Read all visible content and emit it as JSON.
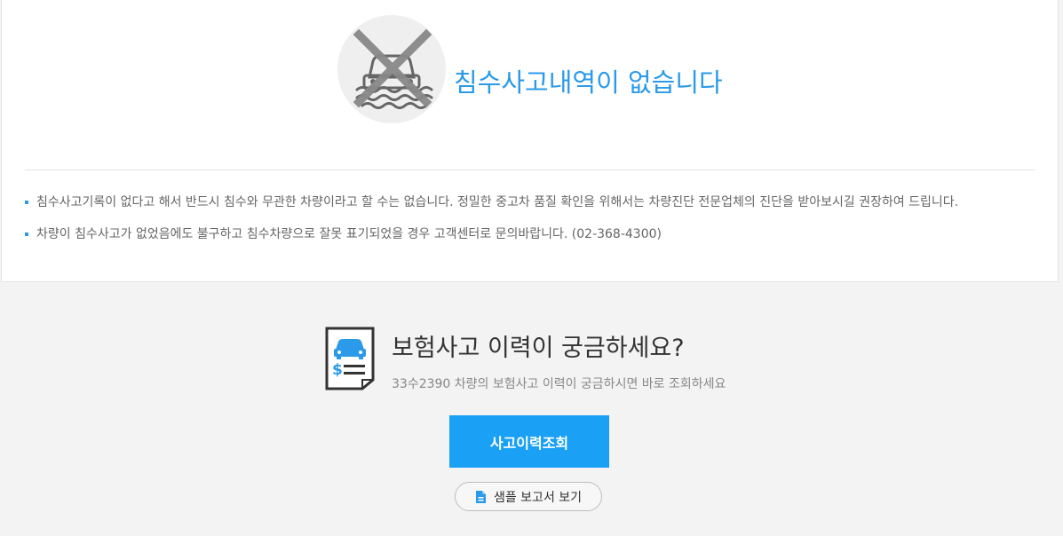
{
  "flood": {
    "icon": "flooded-car-crossed-icon",
    "title": "침수사고내역이 없습니다",
    "notices": [
      "침수사고기록이 없다고 해서 반드시 침수와 무관한 차량이라고 할 수는 없습니다. 정밀한 중고차 품질 확인을 위해서는 차량진단 전문업체의 진단을 받아보시길 권장하여 드립니다.",
      "차량이 침수사고가 없었음에도 불구하고 침수차량으로 잘못 표기되었을 경우 고객센터로 문의바랍니다. (02-368-4300)"
    ]
  },
  "insurance": {
    "icon": "insurance-document-car-icon",
    "title": "보험사고 이력이 궁금하세요?",
    "subtitle": "33수2390 차량의 보험사고 이력이 궁금하시면 바로 조회하세요",
    "history_button": "사고이력조회",
    "sample_button": "샘플 보고서 보기",
    "sample_icon": "document-icon"
  },
  "colors": {
    "accent": "#2b9ae8",
    "button": "#1aa0f4"
  }
}
